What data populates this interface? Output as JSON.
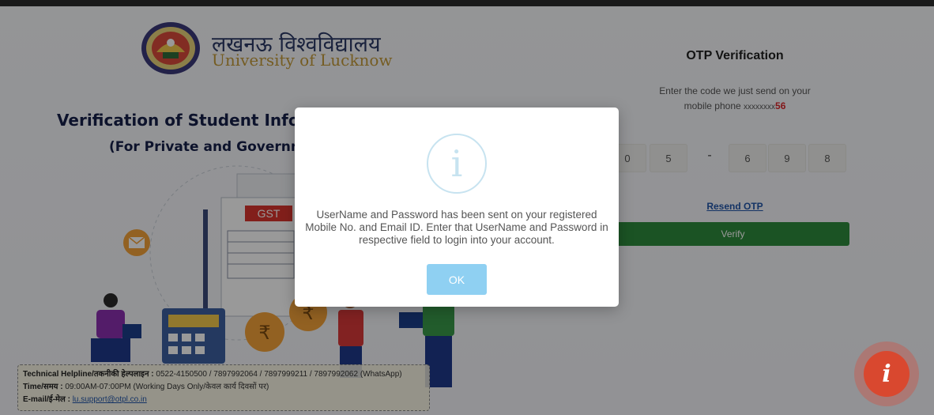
{
  "header": {
    "brand_hindi": "लखनऊ विश्वविद्यालय",
    "brand_english": "University of Lucknow",
    "heading": "Verification of Student Inforr",
    "subheading": "(For Private and Governm"
  },
  "otp": {
    "title": "OTP Verification",
    "description_line1": "Enter the code we just send on your",
    "description_line2_prefix": "mobile phone ",
    "masked_number": "xxxxxxxx",
    "number_tail": "56",
    "digits": [
      "0",
      "5",
      "6",
      "9",
      "8"
    ],
    "separator": "-",
    "resend_label": "Resend OTP",
    "verify_label": "Verify"
  },
  "modal": {
    "icon": "info-icon",
    "icon_glyph": "i",
    "message": "UserName and Password has been sent on your registered Mobile No. and Email ID. Enter that UserName and Password in respective field to login into your account.",
    "ok_label": "OK"
  },
  "helpline": {
    "line1_label": "Technical Helpline/तकनीकी हेल्पलाइन :",
    "line1_value": "0522-4150500 / 7897992064 / 7897999211 / 7897992062 (WhatsApp)",
    "line2_label": "Time/समय :",
    "line2_value": "09:00AM-07:00PM (Working Days Only/केवल कार्य दिवसों पर)",
    "line3_label": "E-mail/ई-मेल :",
    "line3_value": "lu.support@otpl.co.in"
  },
  "illustration": {
    "gst_label": "GST",
    "rupee_symbol": "₹"
  },
  "fab": {
    "icon": "info-icon",
    "glyph": "i"
  },
  "colors": {
    "overlay": "#000000",
    "verify_button": "#2e8b3c",
    "ok_button": "#8fd0f2",
    "accent_red": "#d9262a",
    "link_blue": "#2255a8",
    "fab_red": "#d9482f"
  }
}
